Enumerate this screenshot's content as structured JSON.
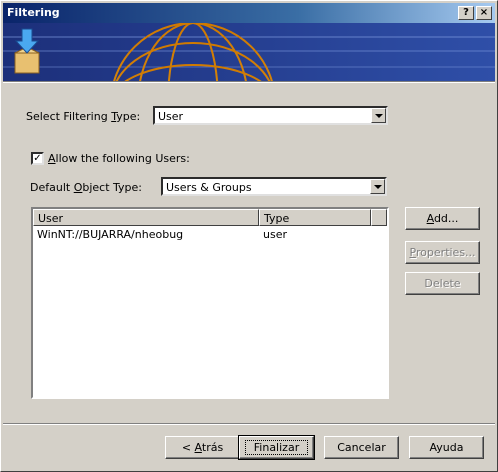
{
  "window": {
    "title": "Filtering",
    "help_glyph": "?",
    "close_glyph": "×"
  },
  "filter_type": {
    "label_pre": "Select Filtering ",
    "label_u": "T",
    "label_post": "ype:",
    "value": "User"
  },
  "allow": {
    "checked": "✓",
    "label_pre": "",
    "label_u": "A",
    "label_post": "llow the following Users:"
  },
  "object_type": {
    "label_pre": "Default ",
    "label_u": "O",
    "label_post": "bject Type:",
    "value": "Users & Groups"
  },
  "list": {
    "columns": [
      "User",
      "Type"
    ],
    "rows": [
      {
        "user": "WinNT://BUJARRA/nheobug",
        "type": "user"
      }
    ]
  },
  "side_buttons": {
    "add": {
      "u": "A",
      "rest": "dd..."
    },
    "properties": {
      "u": "P",
      "rest": "roperties..."
    },
    "delete": "Delete"
  },
  "footer": {
    "back": {
      "pre": "< ",
      "u": "A",
      "rest": "trás"
    },
    "finish": "Finalizar",
    "cancel": "Cancelar",
    "help": "Ayuda"
  }
}
